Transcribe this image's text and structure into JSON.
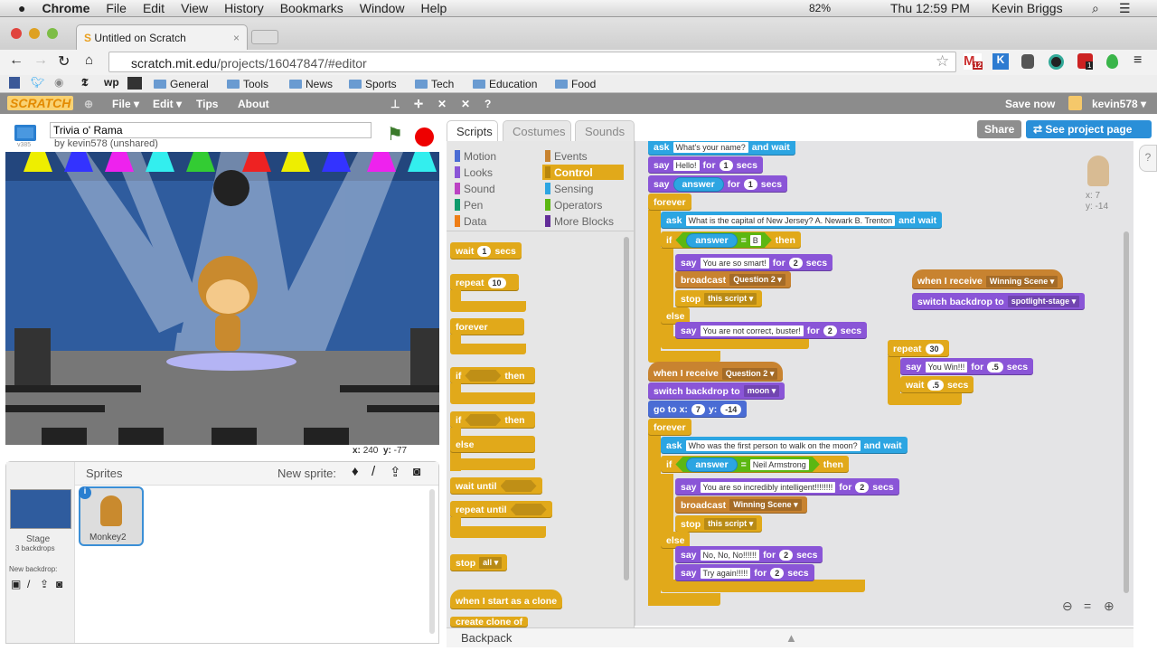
{
  "mac_menu": {
    "app": "Chrome",
    "items": [
      "File",
      "Edit",
      "View",
      "History",
      "Bookmarks",
      "Window",
      "Help"
    ],
    "battery": "82%",
    "clock": "Thu 12:59 PM",
    "user": "Kevin Briggs"
  },
  "browser": {
    "tab_title": "Untitled on Scratch",
    "url_host": "scratch.mit.edu",
    "url_path": "/projects/16047847/#editor",
    "gmail_badge": "12",
    "ext_badge": "1",
    "bookmarks": [
      "General",
      "Tools",
      "News",
      "Sports",
      "Tech",
      "Education",
      "Food"
    ]
  },
  "scratch_menu": {
    "logo": "SCRATCH",
    "file": "File ▾",
    "edit": "Edit ▾",
    "tips": "Tips",
    "about": "About",
    "save": "Save now",
    "username": "kevin578 ▾"
  },
  "project": {
    "title": "Trivia o' Rama",
    "byline": "by kevin578 (unshared)",
    "version": "v385"
  },
  "stage_coords": {
    "x_label": "x:",
    "x": "240",
    "y_label": "y:",
    "y": "-77"
  },
  "sprites_pane": {
    "title": "Sprites",
    "new_sprite": "New sprite:",
    "stage_label": "Stage",
    "backdrops": "3 backdrops",
    "new_backdrop": "New backdrop:",
    "sprite_name": "Monkey2"
  },
  "tabs": [
    "Scripts",
    "Costumes",
    "Sounds"
  ],
  "buttons": {
    "share": "Share",
    "see_project": "See project page"
  },
  "categories": {
    "left": [
      "Motion",
      "Looks",
      "Sound",
      "Pen",
      "Data"
    ],
    "right": [
      "Events",
      "Control",
      "Sensing",
      "Operators",
      "More Blocks"
    ],
    "selected": "Control"
  },
  "palette_blocks": {
    "wait": "wait",
    "wait_val": "1",
    "secs": "secs",
    "repeat": "repeat",
    "repeat_val": "10",
    "forever": "forever",
    "if": "if",
    "then": "then",
    "else": "else",
    "wait_until": "wait until",
    "repeat_until": "repeat until",
    "stop": "stop",
    "stop_val": "all",
    "clone_hat": "when I start as a clone",
    "create_clone": "create clone of"
  },
  "sprite_info": {
    "x": "x: 7",
    "y": "y: -14"
  },
  "backpack": "Backpack",
  "scripts": [
    {
      "cat": "sensing",
      "parts": [
        [
          "t",
          "ask"
        ],
        [
          "s",
          "What's your name?"
        ],
        [
          "t",
          "and wait"
        ]
      ]
    },
    {
      "cat": "looks",
      "parts": [
        [
          "t",
          "say"
        ],
        [
          "s",
          "Hello!"
        ],
        [
          "t",
          "for"
        ],
        [
          "n",
          "1"
        ],
        [
          "t",
          "secs"
        ]
      ]
    },
    {
      "cat": "looks",
      "parts": [
        [
          "t",
          "say"
        ],
        [
          "r",
          "answer"
        ],
        [
          "t",
          "for"
        ],
        [
          "n",
          "1"
        ],
        [
          "t",
          "secs"
        ]
      ]
    },
    {
      "cat": "control",
      "parts": [
        [
          "t",
          "forever"
        ]
      ]
    },
    {
      "cat": "sensing",
      "parts": [
        [
          "t",
          "ask"
        ],
        [
          "s",
          "What is the capital of New Jersey?  A. Newark   B. Trenton"
        ],
        [
          "t",
          "and wait"
        ]
      ]
    },
    {
      "cat": "control",
      "parts": [
        [
          "t",
          "if"
        ],
        [
          "g",
          [
            [
              "r",
              "answer"
            ],
            [
              "t",
              "="
            ],
            [
              "s",
              "B"
            ]
          ]
        ],
        [
          "t",
          "then"
        ]
      ]
    },
    {
      "cat": "looks",
      "parts": [
        [
          "t",
          "say"
        ],
        [
          "s",
          "You are so smart!"
        ],
        [
          "t",
          "for"
        ],
        [
          "n",
          "2"
        ],
        [
          "t",
          "secs"
        ]
      ]
    },
    {
      "cat": "events",
      "parts": [
        [
          "t",
          "broadcast"
        ],
        [
          "d",
          "Question 2"
        ]
      ]
    },
    {
      "cat": "control",
      "parts": [
        [
          "t",
          "stop"
        ],
        [
          "d",
          "this script"
        ]
      ]
    },
    {
      "cat": "control",
      "parts": [
        [
          "t",
          "else"
        ]
      ]
    },
    {
      "cat": "looks",
      "parts": [
        [
          "t",
          "say"
        ],
        [
          "s",
          "You are not correct, buster!"
        ],
        [
          "t",
          "for"
        ],
        [
          "n",
          "2"
        ],
        [
          "t",
          "secs"
        ]
      ]
    },
    {
      "cat": "events",
      "hat": true,
      "parts": [
        [
          "t",
          "when I receive"
        ],
        [
          "d",
          "Question 2"
        ]
      ]
    },
    {
      "cat": "looks",
      "parts": [
        [
          "t",
          "switch backdrop to"
        ],
        [
          "d",
          "moon"
        ]
      ]
    },
    {
      "cat": "motion",
      "parts": [
        [
          "t",
          "go to x:"
        ],
        [
          "n",
          "7"
        ],
        [
          "t",
          "y:"
        ],
        [
          "n",
          "-14"
        ]
      ]
    },
    {
      "cat": "control",
      "parts": [
        [
          "t",
          "forever"
        ]
      ]
    },
    {
      "cat": "sensing",
      "parts": [
        [
          "t",
          "ask"
        ],
        [
          "s",
          "Who was the first person to walk on the moon?"
        ],
        [
          "t",
          "and wait"
        ]
      ]
    },
    {
      "cat": "control",
      "parts": [
        [
          "t",
          "if"
        ],
        [
          "g",
          [
            [
              "r",
              "answer"
            ],
            [
              "t",
              "="
            ],
            [
              "s",
              "Neil Armstrong"
            ]
          ]
        ],
        [
          "t",
          "then"
        ]
      ]
    },
    {
      "cat": "looks",
      "parts": [
        [
          "t",
          "say"
        ],
        [
          "s",
          "You are so incredibly intelligent!!!!!!!!"
        ],
        [
          "t",
          "for"
        ],
        [
          "n",
          "2"
        ],
        [
          "t",
          "secs"
        ]
      ]
    },
    {
      "cat": "events",
      "parts": [
        [
          "t",
          "broadcast"
        ],
        [
          "d",
          "Winning Scene"
        ]
      ]
    },
    {
      "cat": "control",
      "parts": [
        [
          "t",
          "stop"
        ],
        [
          "d",
          "this script"
        ]
      ]
    },
    {
      "cat": "control",
      "parts": [
        [
          "t",
          "else"
        ]
      ]
    },
    {
      "cat": "looks",
      "parts": [
        [
          "t",
          "say"
        ],
        [
          "s",
          "No, No, No!!!!!!"
        ],
        [
          "t",
          "for"
        ],
        [
          "n",
          "2"
        ],
        [
          "t",
          "secs"
        ]
      ]
    },
    {
      "cat": "looks",
      "parts": [
        [
          "t",
          "say"
        ],
        [
          "s",
          "Try again!!!!!"
        ],
        [
          "t",
          "for"
        ],
        [
          "n",
          "2"
        ],
        [
          "t",
          "secs"
        ]
      ]
    },
    {
      "cat": "events",
      "hat": true,
      "parts": [
        [
          "t",
          "when I receive"
        ],
        [
          "d",
          "Winning Scene"
        ]
      ]
    },
    {
      "cat": "looks",
      "parts": [
        [
          "t",
          "switch backdrop to"
        ],
        [
          "d",
          "spotlight-stage"
        ]
      ]
    },
    {
      "cat": "control",
      "parts": [
        [
          "t",
          "repeat"
        ],
        [
          "n",
          "30"
        ]
      ]
    },
    {
      "cat": "looks",
      "parts": [
        [
          "t",
          "say"
        ],
        [
          "s",
          "You Win!!!"
        ],
        [
          "t",
          "for"
        ],
        [
          "n",
          ".5"
        ],
        [
          "t",
          "secs"
        ]
      ]
    },
    {
      "cat": "control",
      "parts": [
        [
          "t",
          "wait"
        ],
        [
          "n",
          ".5"
        ],
        [
          "t",
          "secs"
        ]
      ]
    }
  ]
}
